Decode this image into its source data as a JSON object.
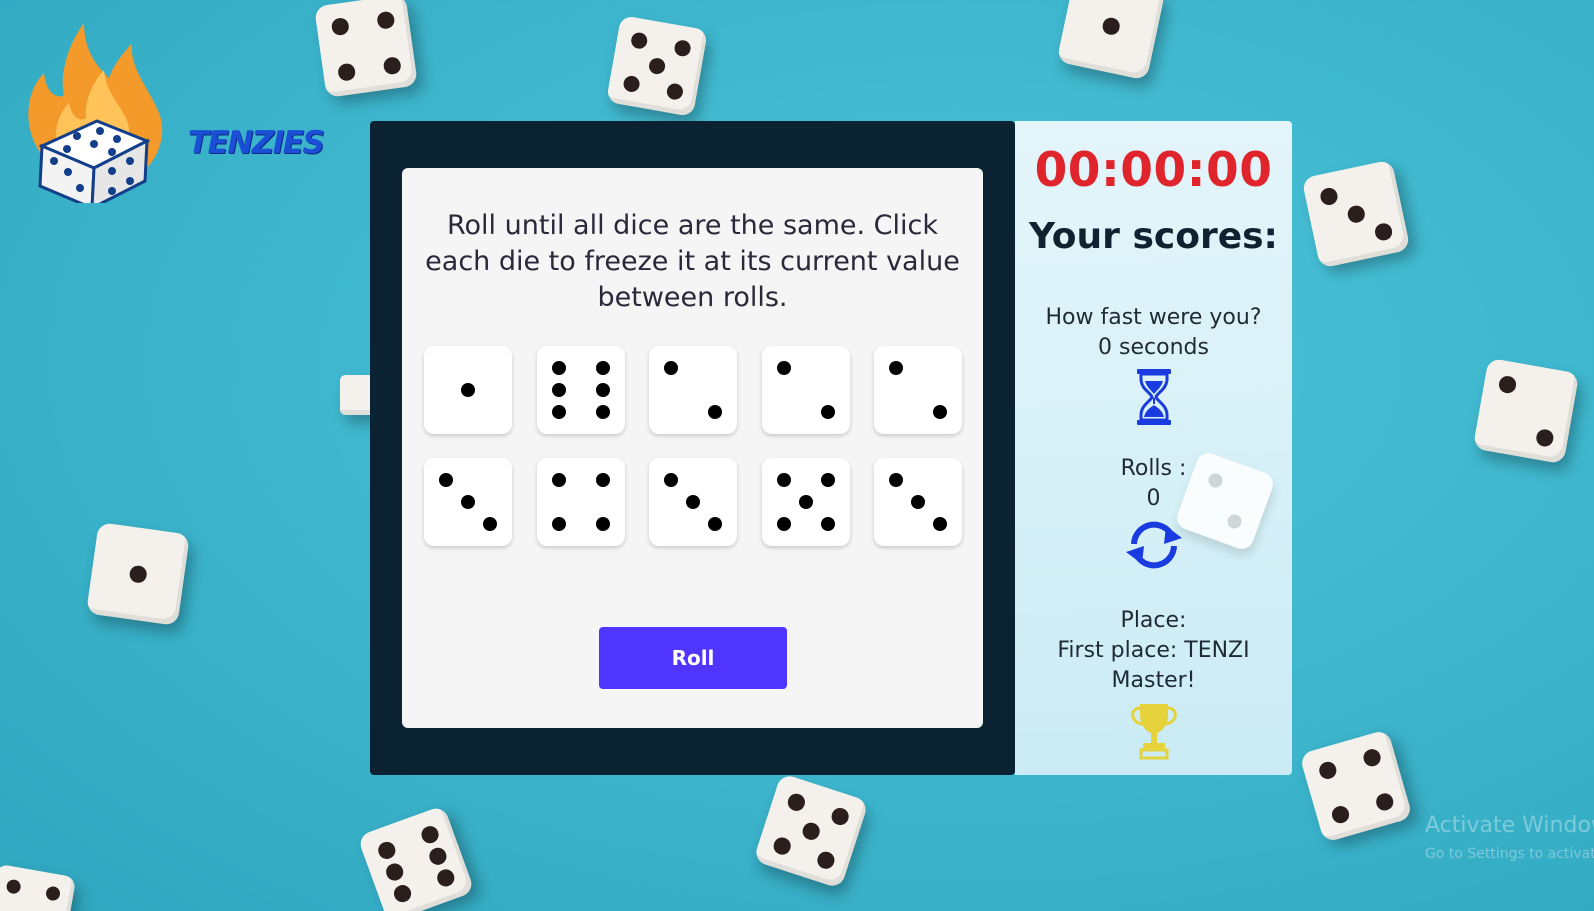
{
  "app": {
    "brand_name": "TENZIES"
  },
  "game": {
    "instructions": "Roll until all dice are the same. Click each die to freeze it at its current value between rolls.",
    "dice": [
      1,
      6,
      2,
      2,
      2,
      3,
      4,
      3,
      5,
      3
    ],
    "roll_button_label": "Roll"
  },
  "scores": {
    "timer": "00:00:00",
    "title": "Your scores:",
    "fast_label": "How fast were you?",
    "fast_value": "0 seconds",
    "rolls_label": "Rolls :",
    "rolls_value": "0",
    "place_label": "Place:",
    "place_value": "First place: TENZI Master!"
  },
  "watermark": {
    "title": "Activate Windows",
    "subtitle": "Go to Settings to activate Windows."
  },
  "colors": {
    "background": "#3fb8cf",
    "frame": "#0b2233",
    "board": "#f5f5f5",
    "accent_button": "#5035ff",
    "timer": "#e0242b",
    "icon_blue": "#1a3be0",
    "trophy": "#e6d23a",
    "logo_flame": "#f39a2a"
  },
  "icons": {
    "logo": "flaming-die-logo",
    "time": "hourglass-icon",
    "rolls": "refresh-icon",
    "place": "trophy-icon"
  }
}
